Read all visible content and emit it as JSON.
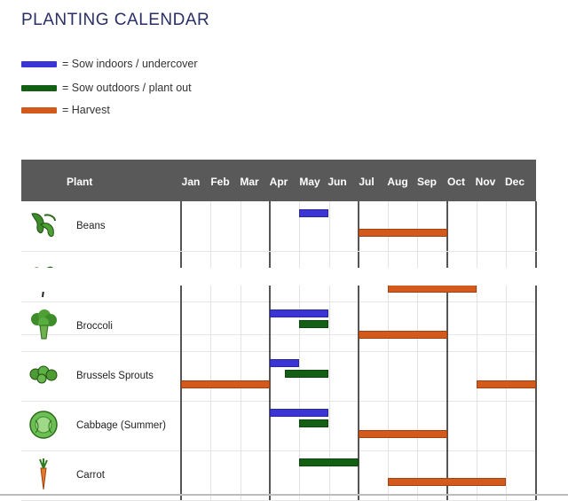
{
  "page": {
    "title": "PLANTING CALENDAR"
  },
  "legend": [
    {
      "label": "= Sow indoors / undercover",
      "color": "#3b35d6"
    },
    {
      "label": "= Sow outdoors / plant out",
      "color": "#135f13"
    },
    {
      "label": "= Harvest",
      "color": "#d35a1c"
    }
  ],
  "table": {
    "plant_header": "Plant",
    "months": [
      "Jan",
      "Feb",
      "Mar",
      "Apr",
      "May",
      "Jun",
      "Jul",
      "Aug",
      "Sep",
      "Oct",
      "Nov",
      "Dec"
    ]
  },
  "rows": [
    {
      "name": "Beans",
      "icon": "beans-icon"
    },
    {
      "name": "",
      "icon": "seedling-icon"
    },
    {
      "name": "",
      "icon": "stem-icon"
    },
    {
      "name": "Broccoli",
      "icon": "broccoli-icon"
    },
    {
      "name": "Brussels Sprouts",
      "icon": "brussels-sprouts-icon"
    },
    {
      "name": "Cabbage (Summer)",
      "icon": "cabbage-icon"
    },
    {
      "name": "Carrot",
      "icon": "carrot-icon"
    }
  ],
  "schedule": [
    {
      "plant": "Beans",
      "sow_indoors": [
        [
          5,
          5
        ]
      ],
      "sow_outdoors": [],
      "harvest": [
        [
          7,
          9
        ]
      ]
    },
    {
      "plant": "",
      "sow_indoors": [],
      "sow_outdoors": [],
      "harvest": []
    },
    {
      "plant": "",
      "sow_indoors": [],
      "sow_outdoors": [],
      "harvest": [
        [
          8,
          10
        ]
      ]
    },
    {
      "plant": "Broccoli",
      "sow_indoors": [
        [
          4,
          5
        ]
      ],
      "sow_outdoors": [
        [
          5,
          5
        ]
      ],
      "harvest": [
        [
          7,
          9
        ]
      ]
    },
    {
      "plant": "Brussels Sprouts",
      "sow_indoors": [
        [
          4,
          4
        ]
      ],
      "sow_outdoors": [
        [
          4.5,
          5
        ]
      ],
      "harvest": [
        [
          1,
          3
        ],
        [
          11,
          12
        ]
      ]
    },
    {
      "plant": "Cabbage (Summer)",
      "sow_indoors": [
        [
          4,
          5
        ]
      ],
      "sow_outdoors": [
        [
          5,
          5
        ]
      ],
      "harvest": [
        [
          7,
          9
        ]
      ]
    },
    {
      "plant": "Carrot",
      "sow_indoors": [],
      "sow_outdoors": [
        [
          5,
          6
        ]
      ],
      "harvest": [
        [
          8,
          11
        ]
      ]
    }
  ]
}
